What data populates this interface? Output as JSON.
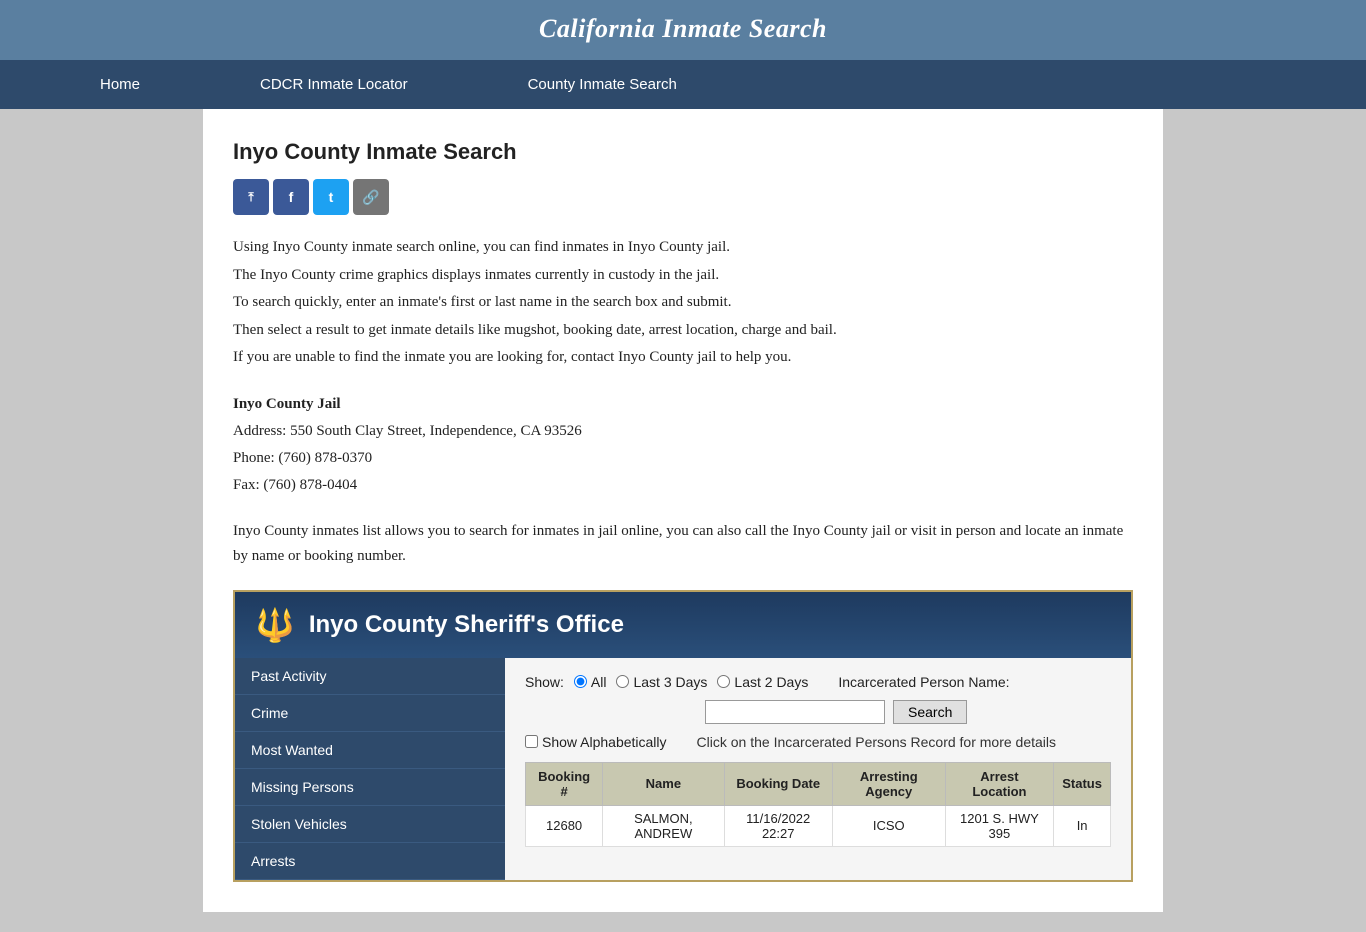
{
  "header": {
    "title": "California Inmate Search"
  },
  "nav": {
    "items": [
      {
        "label": "Home",
        "id": "home"
      },
      {
        "label": "CDCR Inmate Locator",
        "id": "cdcr"
      },
      {
        "label": "County Inmate Search",
        "id": "county"
      }
    ]
  },
  "main": {
    "page_title": "Inyo County Inmate Search",
    "social": {
      "share_label": "Share",
      "facebook_label": "f",
      "twitter_label": "t",
      "link_label": "🔗"
    },
    "description_lines": [
      "Using Inyo County inmate search online, you can find inmates in Inyo County jail.",
      "The Inyo County crime graphics displays inmates currently in custody in the jail.",
      "To search quickly, enter an inmate's first or last name in the search box and submit.",
      "Then select a result to get inmate details like mugshot, booking date, arrest location, charge and bail.",
      "If you are unable to find the inmate you are looking for, contact Inyo County jail to help you."
    ],
    "jail_info": {
      "name": "Inyo County Jail",
      "address": "Address: 550 South Clay Street, Independence, CA 93526",
      "phone": "Phone: (760) 878-0370",
      "fax": "Fax: (760) 878-0404"
    },
    "bottom_desc": "Inyo County inmates list allows you to search for inmates in jail online, you can also call the Inyo County jail or visit in person and locate an inmate by name or booking number.",
    "sheriff_widget": {
      "header_title": "Inyo County Sheriff's Office",
      "badge_icon": "⭐",
      "sidebar_items": [
        "Past Activity",
        "Crime",
        "Most Wanted",
        "Missing Persons",
        "Stolen Vehicles",
        "Arrests"
      ],
      "search_section": {
        "show_label": "Show:",
        "radio_all": "All",
        "radio_last3": "Last 3 Days",
        "radio_last2": "Last 2 Days",
        "incarcerated_label": "Incarcerated Person Name:",
        "search_placeholder": "",
        "search_button": "Search",
        "show_alpha_label": "Show Alphabetically",
        "click_info": "Click on the Incarcerated Persons Record for more details"
      },
      "table": {
        "columns": [
          "Booking #",
          "Name",
          "Booking Date",
          "Arresting Agency",
          "Arrest Location",
          "Status"
        ],
        "rows": [
          {
            "booking": "12680",
            "name": "SALMON, ANDREW",
            "booking_date": "11/16/2022 22:27",
            "arresting_agency": "ICSO",
            "arrest_location": "1201 S. HWY 395",
            "status": "In"
          }
        ]
      }
    }
  }
}
